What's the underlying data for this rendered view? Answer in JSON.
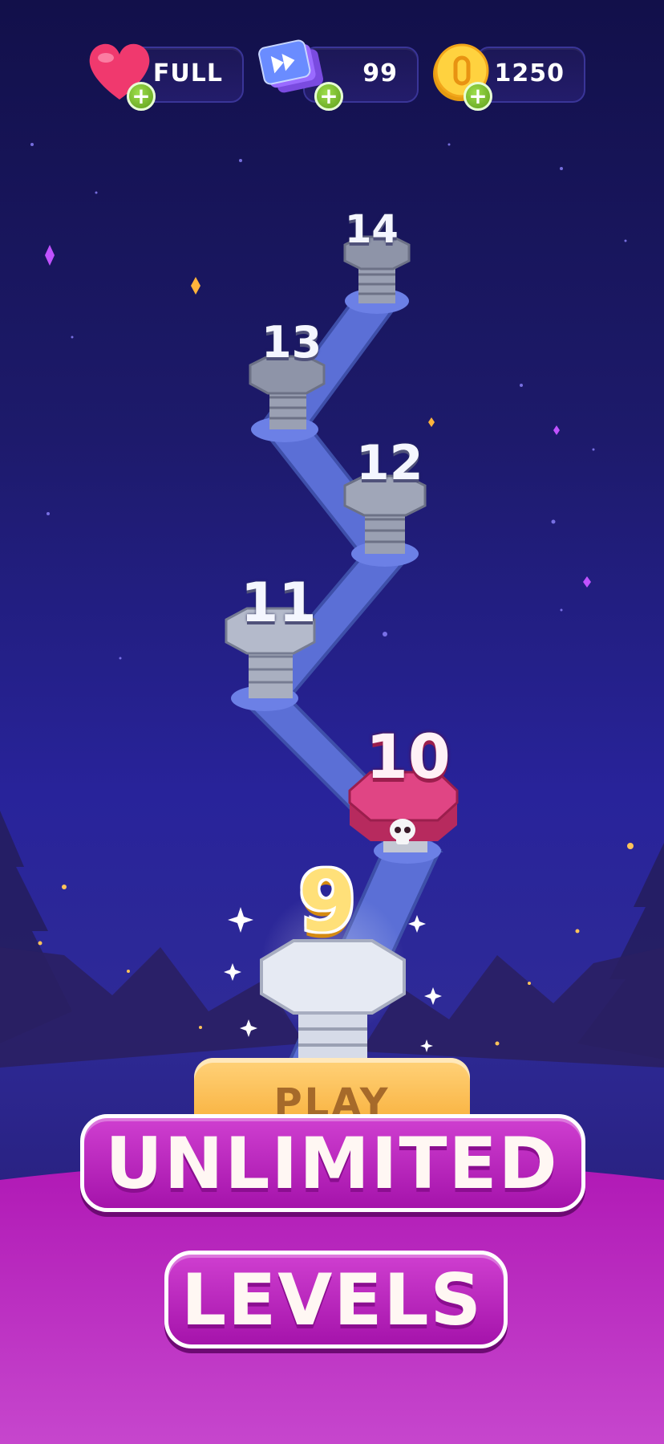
{
  "hud": {
    "lives": {
      "value": "FULL",
      "icon": "heart-icon"
    },
    "tickets": {
      "value": "99",
      "icon": "skip-cards-icon"
    },
    "coins": {
      "value": "1250",
      "icon": "coin-icon"
    },
    "plus_label": "+"
  },
  "level_path": {
    "levels": [
      "14",
      "13",
      "12",
      "11",
      "10",
      "9"
    ],
    "current_level": "9",
    "hard_level": "10",
    "hard_level_icon": "skull-icon"
  },
  "play_button": {
    "label": "PLAY"
  },
  "promo": {
    "line1": "UNLIMITED",
    "line2": "LEVELS"
  },
  "colors": {
    "path": "#5b6fd6",
    "bolt": "#9aa0b3",
    "hard_bolt": "#d6386f",
    "current_level_number": "#ffe079",
    "promo_banner": "#a513ab",
    "play_button": "#f7a72a"
  }
}
